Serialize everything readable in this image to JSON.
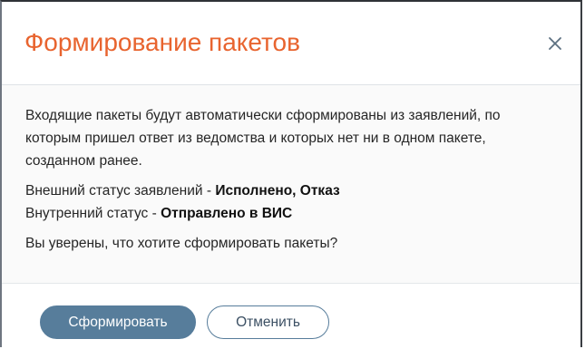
{
  "dialog": {
    "title": "Формирование пакетов",
    "close_icon": "close-icon",
    "body": {
      "paragraph1": "Входящие пакеты будут автоматически сформированы из заявлений, по которым пришел ответ из ведомства и которых нет ни в одном пакете, созданном ранее.",
      "external_status_label": "Внешний статус заявлений - ",
      "external_status_value": "Исполнено, Отказ",
      "internal_status_label": "Внутренний статус - ",
      "internal_status_value": "Отправлено в ВИС",
      "confirm_question": "Вы уверены, что хотите сформировать пакеты?"
    },
    "footer": {
      "submit_label": "Сформировать",
      "cancel_label": "Отменить"
    }
  },
  "colors": {
    "title": "#e8642f",
    "primary_button": "#577d9b",
    "body_background": "#fafafa"
  }
}
